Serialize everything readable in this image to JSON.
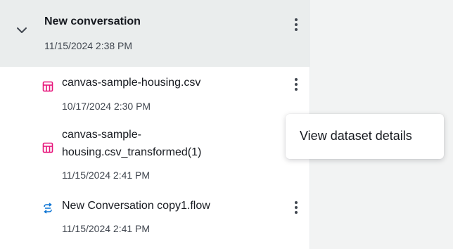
{
  "conversation": {
    "title": "New conversation",
    "date": "11/15/2024 2:38 PM",
    "expanded": true
  },
  "items": [
    {
      "name": "canvas-sample-housing.csv",
      "date": "10/17/2024 2:30 PM",
      "icon": "table-icon"
    },
    {
      "name_line1": "canvas-sample-",
      "name_line2": "housing.csv_transformed(1)",
      "date": "11/15/2024 2:41 PM",
      "icon": "table-icon"
    },
    {
      "name": "New Conversation copy1.flow",
      "date": "11/15/2024 2:41 PM",
      "icon": "flow-icon"
    }
  ],
  "context_menu": {
    "items": [
      "View dataset details"
    ]
  },
  "colors": {
    "table_icon": "#e7157b",
    "flow_icon": "#0972d3",
    "header_bg": "#eaeded"
  }
}
